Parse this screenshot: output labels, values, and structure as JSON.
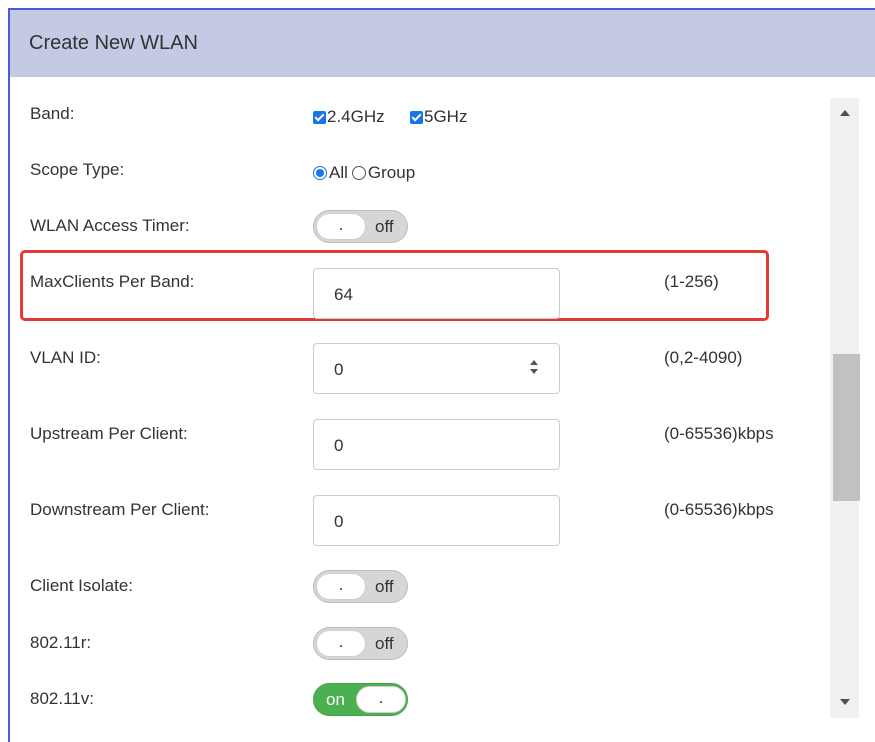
{
  "dialog": {
    "title": "Create New WLAN"
  },
  "band": {
    "label": "Band:",
    "options": [
      {
        "label": "2.4GHz",
        "checked": true
      },
      {
        "label": "5GHz",
        "checked": true
      }
    ]
  },
  "scope_type": {
    "label": "Scope Type:",
    "options": [
      {
        "label": "All",
        "selected": true
      },
      {
        "label": "Group",
        "selected": false
      }
    ]
  },
  "wlan_access_timer": {
    "label": "WLAN Access Timer:",
    "knob": ".",
    "state": "off"
  },
  "max_clients": {
    "label": "MaxClients Per Band:",
    "value": "64",
    "range": "(1-256)"
  },
  "vlan_id": {
    "label": "VLAN ID:",
    "value": "0",
    "range": "(0,2-4090)"
  },
  "upstream": {
    "label": "Upstream Per Client:",
    "value": "0",
    "range": "(0-65536)kbps"
  },
  "downstream": {
    "label": "Downstream Per Client:",
    "value": "0",
    "range": "(0-65536)kbps"
  },
  "client_isolate": {
    "label": "Client Isolate:",
    "knob": ".",
    "state": "off"
  },
  "dot11r": {
    "label": "802.11r:",
    "knob": ".",
    "state": "off"
  },
  "dot11v": {
    "label": "802.11v:",
    "knob": ".",
    "state": "on"
  },
  "colors": {
    "header_bg": "#c4cae4",
    "highlight": "#e53935",
    "toggle_on": "#4caf50",
    "accent": "#1a73e8"
  },
  "icons": {
    "scroll_up": "triangle-up-icon",
    "scroll_down": "triangle-down-icon",
    "spinner": "spinner-arrows-icon"
  }
}
